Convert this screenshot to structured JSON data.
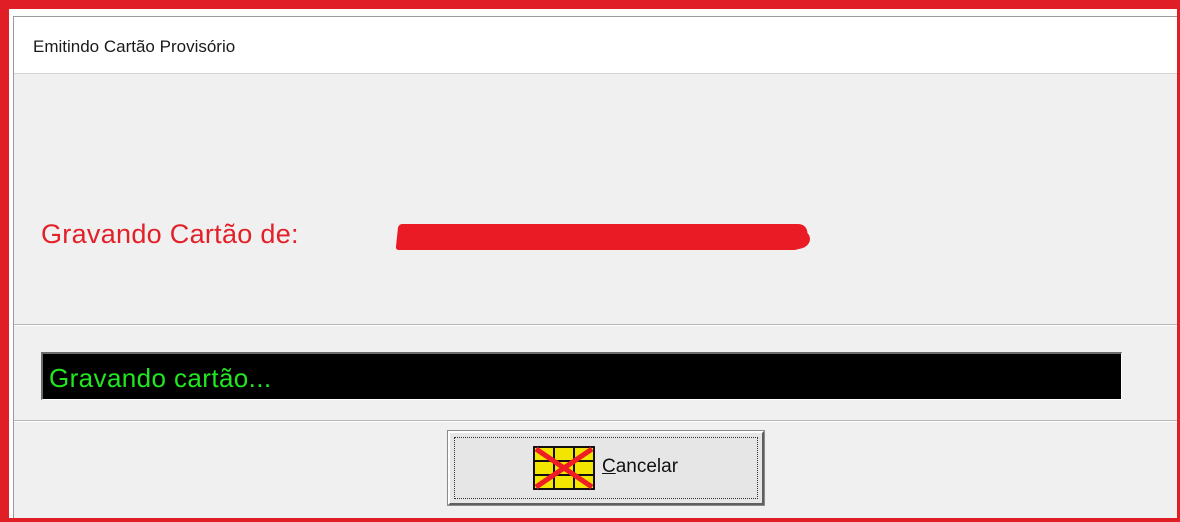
{
  "window": {
    "title": "Emitindo Cartão Provisório"
  },
  "record": {
    "label": "Gravando Cartão de:"
  },
  "status": {
    "text": "Gravando cartão..."
  },
  "buttons": {
    "cancel": {
      "mnemonic": "C",
      "rest": "ancelar",
      "icon": "cancel-card-icon"
    }
  },
  "colors": {
    "highlight_frame": "#e01e26",
    "label_red": "#e32028",
    "status_bg": "#000000",
    "status_text": "#21e621",
    "dialog_bg": "#f0f0f0"
  }
}
